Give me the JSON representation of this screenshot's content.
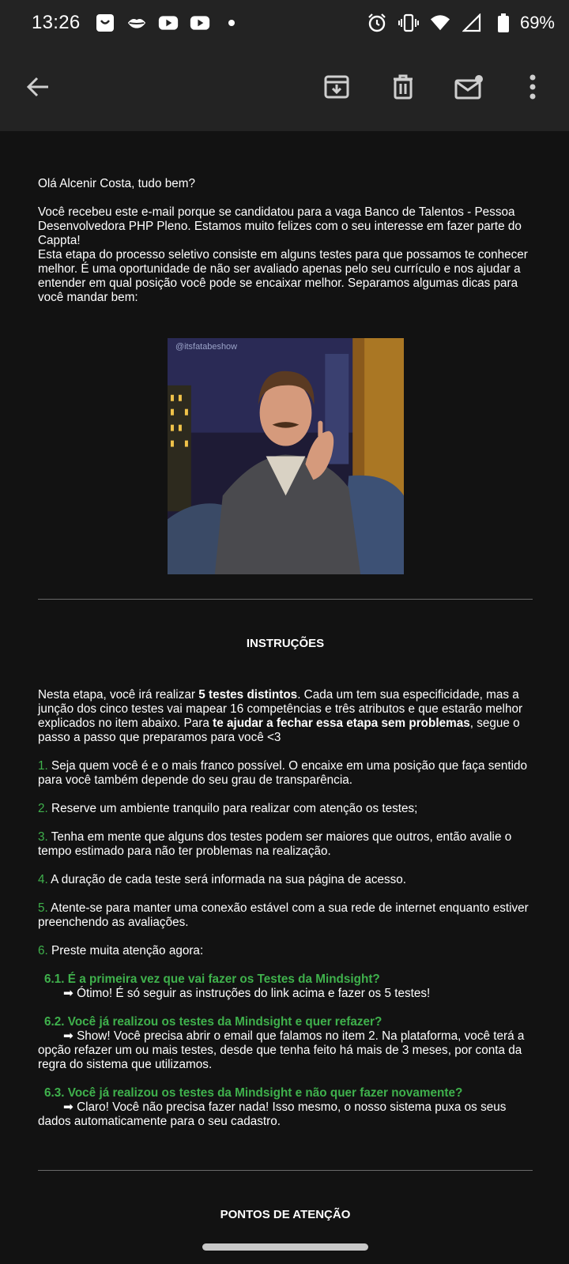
{
  "status_bar": {
    "time": "13:26",
    "battery_percent": "69%",
    "left_icons": [
      "shopee-bag-icon",
      "lips-icon",
      "youtube-icon",
      "youtube-icon",
      "dot-icon"
    ],
    "right_icons": [
      "alarm-icon",
      "vibrate-icon",
      "wifi-icon",
      "signal-icon",
      "battery-icon"
    ]
  },
  "app_bar": {
    "actions": [
      "back-arrow-icon",
      "archive-icon",
      "delete-icon",
      "mark-unread-icon",
      "more-vert-icon"
    ]
  },
  "email": {
    "greeting": "Olá Alcenir Costa, tudo bem?",
    "intro_1": "Você recebeu este e-mail porque se candidatou para a vaga Banco de Talentos - Pessoa Desenvolvedora PHP Pleno. Estamos muito felizes com o seu interesse em fazer parte do Cappta!",
    "intro_2": "Esta etapa do processo seletivo consiste em alguns testes para que possamos te conhecer melhor. É uma oportunidade de não ser avaliado apenas pelo seu currículo e nos ajudar a entender em qual posição você pode se encaixar melhor. Separamos algumas dicas para você mandar bem:",
    "gif_caption": "@itsfatabeshow",
    "section_instrucoes": "INSTRUÇÕES",
    "instr_p1_a": "Nesta etapa, você irá realizar ",
    "instr_p1_b": "5 testes distintos",
    "instr_p1_c": ". Cada um tem sua especificidade, mas a junção dos cinco testes vai mapear 16 competências e três atributos e que estarão melhor explicados no item abaixo. Para ",
    "instr_p1_d": "te ajudar a fechar essa etapa sem problemas",
    "instr_p1_e": ", segue o passo a passo que preparamos para você  <3",
    "items": [
      {
        "num": "1.",
        "text": " Seja quem você é e o mais franco possível. O encaixe em uma posição que faça sentido para você também depende do seu grau de transparência."
      },
      {
        "num": "2.",
        "text": " Reserve um ambiente tranquilo para realizar com atenção os testes;"
      },
      {
        "num": "3.",
        "text": " Tenha em mente que alguns dos testes podem ser maiores que outros, então avalie o tempo estimado para não ter problemas na realização."
      },
      {
        "num": "4.",
        "text": " A duração de cada teste será informada na sua página de acesso."
      },
      {
        "num": "5.",
        "text": " Atente-se para manter uma conexão estável com a sua rede de internet enquanto estiver preenchendo as avaliações."
      },
      {
        "num": "6.",
        "text": " Preste muita atenção agora:"
      }
    ],
    "sub_items": [
      {
        "title": "6.1. É a primeira vez que vai fazer os Testes da Mindsight?",
        "text": "➡ Ótimo! É só seguir as instruções do link acima e fazer os 5 testes!"
      },
      {
        "title": "6.2. Você já realizou os testes da Mindsight e quer refazer?",
        "text": "➡ Show! Você precisa abrir o email que falamos no item 2. Na plataforma, você terá a opção refazer um ou mais testes, desde que tenha feito há mais de 3 meses, por conta da regra do sistema que utilizamos."
      },
      {
        "title": "6.3. Você já realizou os testes da Mindsight e não quer fazer novamente?",
        "text": "➡ Claro! Você não precisa fazer nada! Isso mesmo, o nosso sistema puxa os seus dados automaticamente para o seu cadastro."
      }
    ],
    "section_pontos": "PONTOS DE ATENÇÃO"
  }
}
